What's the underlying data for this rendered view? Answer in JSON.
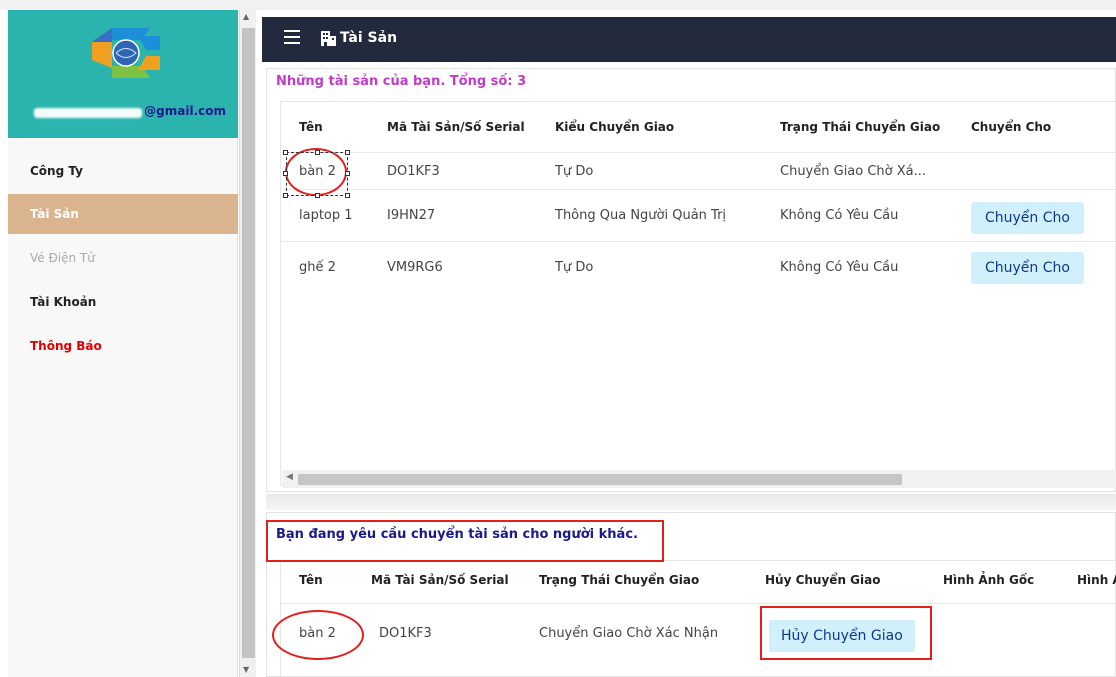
{
  "sidebar": {
    "email": "@gmail.com",
    "items": [
      {
        "label": "Công Ty"
      },
      {
        "label": "Tài Sản"
      },
      {
        "label": "Vé Điện Tử"
      },
      {
        "label": "Tài Khoản"
      },
      {
        "label": "Thông Báo"
      }
    ]
  },
  "header": {
    "title": "Tài Sản",
    "menu_icon": "hamburger-icon",
    "title_icon": "building-icon"
  },
  "assets": {
    "caption": "Những tài sản của bạn. Tổng số: 3",
    "columns": [
      "Tên",
      "Mã Tài Sản/Số Serial",
      "Kiểu Chuyển Giao",
      "Trạng Thái Chuyển Giao",
      "Chuyển Cho"
    ],
    "rows": [
      {
        "name": "bàn 2",
        "serial": "DO1KF3",
        "type": "Tự Do",
        "status": "Chuyển Giao Chờ Xá...",
        "action": ""
      },
      {
        "name": "laptop 1",
        "serial": "I9HN27",
        "type": "Thông Qua Người Quản Trị",
        "status": "Không Có Yêu Cầu",
        "action": "Chuyển Cho"
      },
      {
        "name": "ghế 2",
        "serial": "VM9RG6",
        "type": "Tự Do",
        "status": "Không Có Yêu Cầu",
        "action": "Chuyển Cho"
      }
    ]
  },
  "requests": {
    "caption": "Bạn đang yêu cầu chuyển tài sản cho người khác.",
    "columns": [
      "Tên",
      "Mã Tài Sản/Số Serial",
      "Trạng Thái Chuyển Giao",
      "Hủy Chuyển Giao",
      "Hình Ảnh Gốc",
      "Hình Ả"
    ],
    "rows": [
      {
        "name": "bàn 2",
        "serial": "DO1KF3",
        "status": "Chuyển Giao Chờ Xác Nhận",
        "action": "Hủy Chuyển Giao"
      }
    ]
  },
  "colors": {
    "sidebar_header": "#2bb3ad",
    "active_item": "#d9b48f",
    "topbar": "#232a3d",
    "caption_assets": "#c03cc8",
    "caption_requests": "#1a1a8c",
    "annotation_red": "#e2201c",
    "button_bg": "#d2f0fb"
  }
}
